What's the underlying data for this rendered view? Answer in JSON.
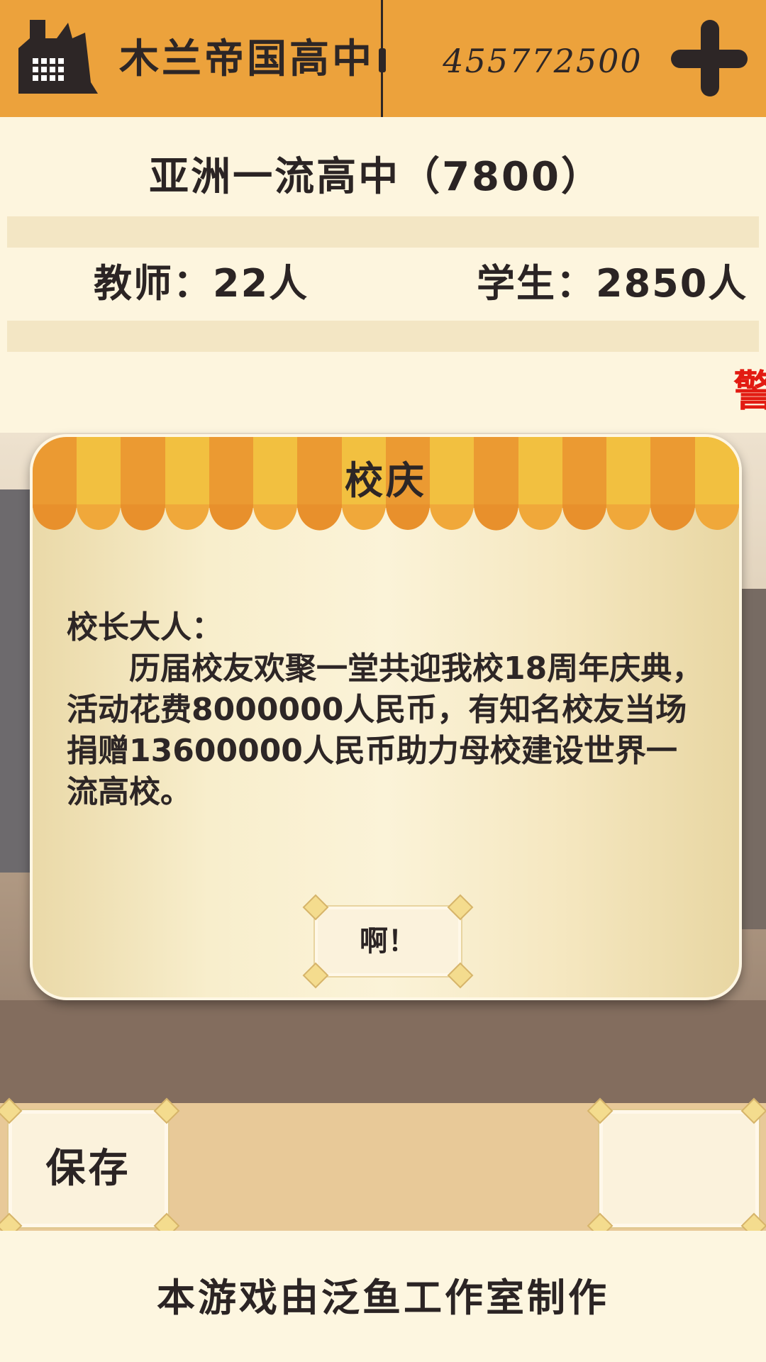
{
  "header": {
    "school_name": "木兰帝国高中",
    "money": "455772500",
    "icons": {
      "school": "factory-school-icon",
      "add": "plus-icon"
    }
  },
  "info": {
    "rank": "亚洲一流高中（7800）",
    "teachers": "教师：22人",
    "students": "学生：2850人",
    "warning": "警"
  },
  "dialog": {
    "title": "校庆",
    "greeting": "校长大人：",
    "message": "历届校友欢聚一堂共迎我校18周年庆典，活动花费8000000人民币，有知名校友当场捐赠13600000人民币助力母校建设世界一流高校。",
    "ok_label": "啊！"
  },
  "bottom": {
    "save_label": "保存",
    "credit": "本游戏由泛鱼工作室制作"
  },
  "colors": {
    "topbar": "#eca23c",
    "awning_light": "#f2c040",
    "awning_dark": "#eb9a32",
    "warning": "#e21b12"
  }
}
